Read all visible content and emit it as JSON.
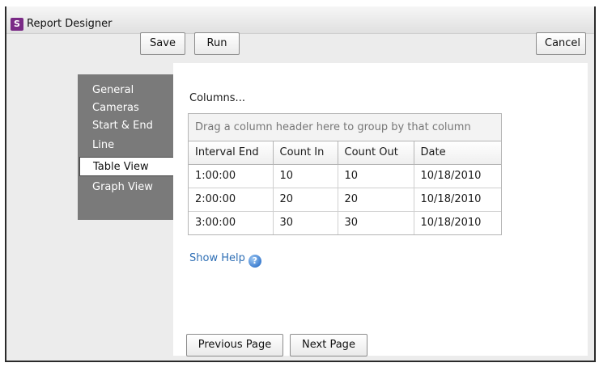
{
  "window": {
    "title": "Report Designer",
    "icon_letter": "S"
  },
  "toolbar": {
    "save_label": "Save",
    "run_label": "Run",
    "cancel_label": "Cancel"
  },
  "nav": {
    "items": [
      {
        "label": "General"
      },
      {
        "label": "Cameras"
      },
      {
        "label": "Start & End"
      },
      {
        "label": "Line"
      },
      {
        "label": "Table View",
        "active": true
      },
      {
        "label": "Graph View"
      }
    ]
  },
  "content": {
    "columns_label": "Columns...",
    "group_hint": "Drag a column header here to group by that column",
    "table": {
      "headers": [
        "Interval End",
        "Count In",
        "Count Out",
        "Date"
      ],
      "rows": [
        [
          "1:00:00",
          "10",
          "10",
          "10/18/2010"
        ],
        [
          "2:00:00",
          "20",
          "20",
          "10/18/2010"
        ],
        [
          "3:00:00",
          "30",
          "30",
          "10/18/2010"
        ]
      ]
    },
    "show_help": "Show Help",
    "help_icon": "?",
    "prev_label": "Previous Page",
    "next_label": "Next Page"
  }
}
